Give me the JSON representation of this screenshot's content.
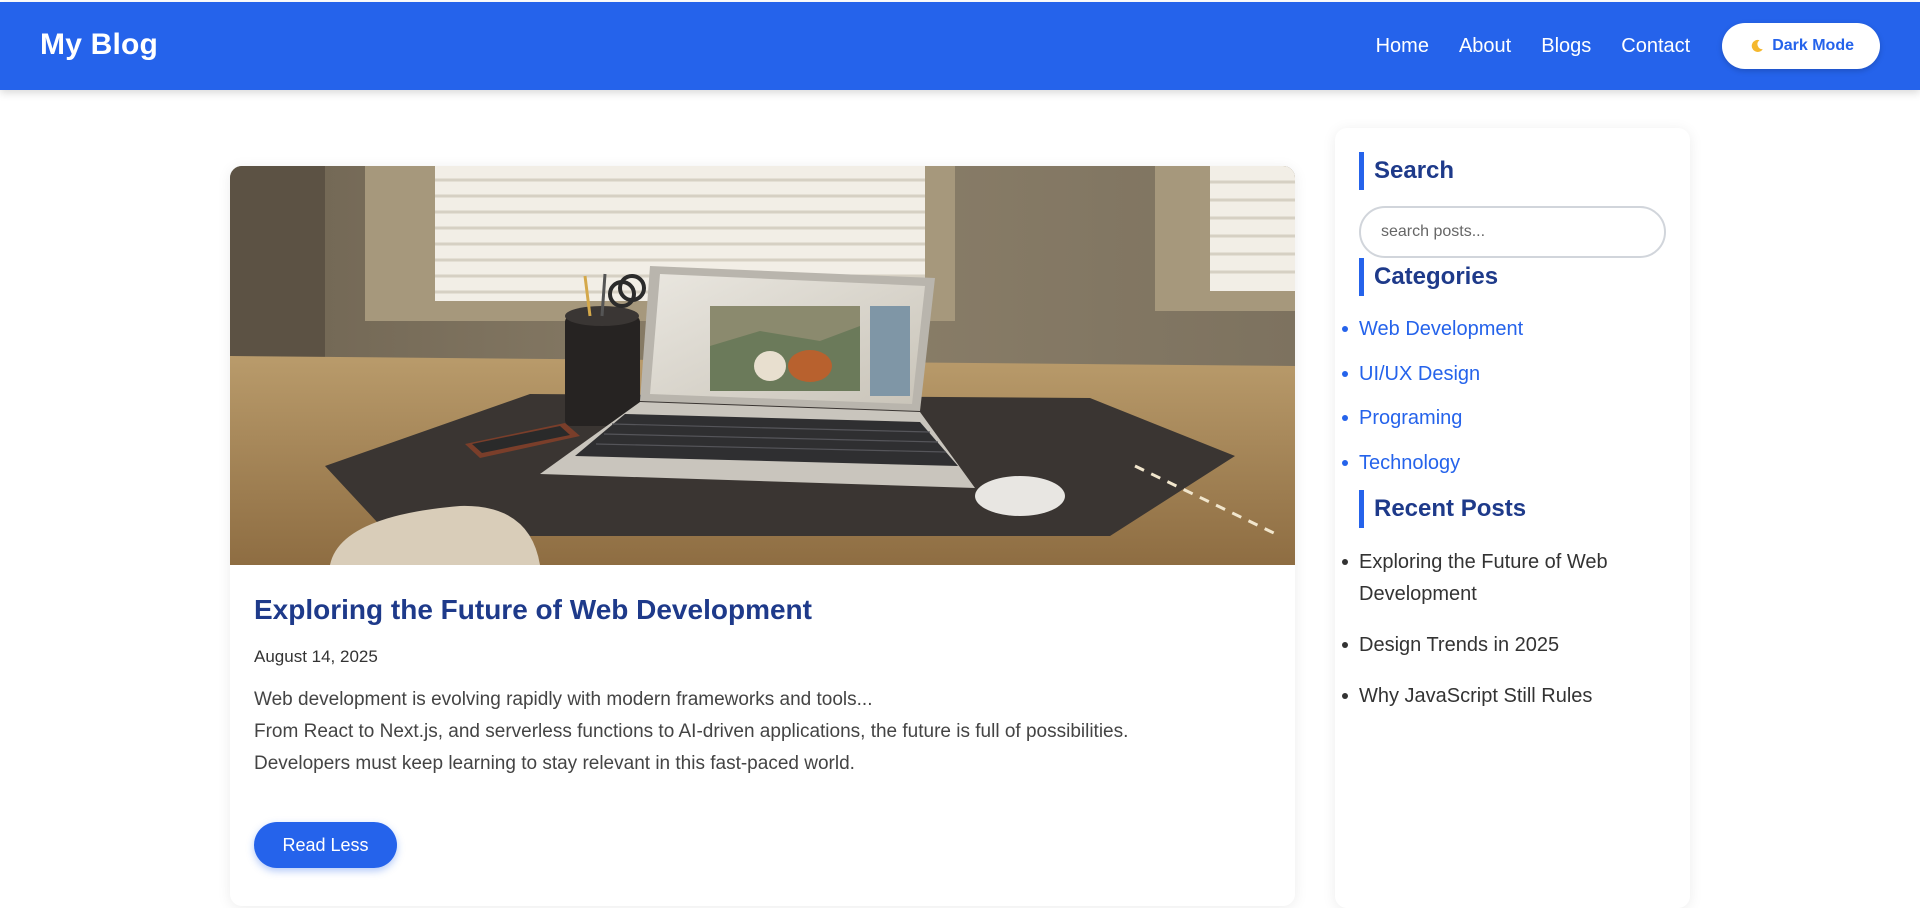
{
  "header": {
    "brand": "My Blog",
    "nav": [
      "Home",
      "About",
      "Blogs",
      "Contact"
    ],
    "dark_mode_label": "Dark Mode"
  },
  "post": {
    "title": "Exploring the Future of Web Development",
    "date": "August 14, 2025",
    "body": [
      "Web development is evolving rapidly with modern frameworks and tools...",
      "From React to Next.js, and serverless functions to AI-driven applications, the future is full of possibilities.",
      "Developers must keep learning to stay relevant in this fast-paced world."
    ],
    "read_button": "Read Less"
  },
  "sidebar": {
    "search_heading": "Search",
    "search_placeholder": "search posts...",
    "categories_heading": "Categories",
    "categories": [
      "Web Development",
      "UI/UX Design",
      "Programing",
      "Technology"
    ],
    "recent_heading": "Recent Posts",
    "recent": [
      "Exploring the Future of Web Development",
      "Design Trends in 2025",
      "Why JavaScript Still Rules"
    ]
  },
  "colors": {
    "primary": "#2563eb",
    "heading": "#1e3a8a"
  }
}
